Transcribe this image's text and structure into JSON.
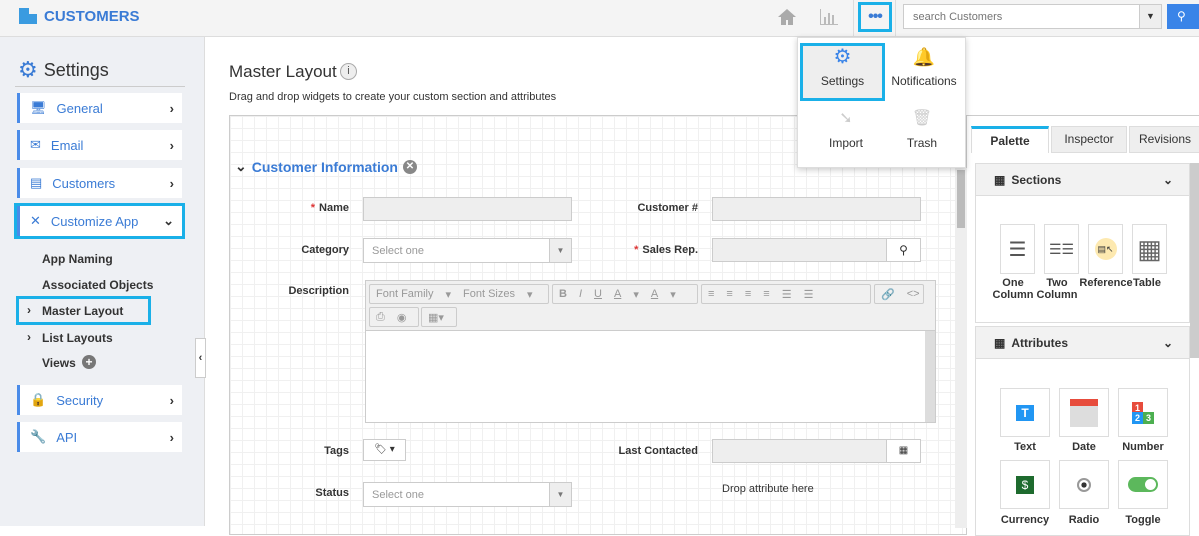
{
  "header": {
    "brand": "CUSTOMERS",
    "search_placeholder": "search Customers",
    "icons": [
      "home-icon",
      "chart-icon",
      "more-icon",
      "search-icon"
    ]
  },
  "menu": {
    "items": [
      {
        "label": "Settings",
        "icon": "gear-icon"
      },
      {
        "label": "Notifications",
        "icon": "bell-icon"
      },
      {
        "label": "Import",
        "icon": "import-icon"
      },
      {
        "label": "Trash",
        "icon": "trash-icon"
      }
    ]
  },
  "sidebar": {
    "title": "Settings",
    "items": [
      {
        "label": "General"
      },
      {
        "label": "Email"
      },
      {
        "label": "Customers"
      },
      {
        "label": "Customize App"
      },
      {
        "label": "Security"
      },
      {
        "label": "API"
      }
    ],
    "subitems": [
      "App Naming",
      "Associated Objects",
      "Master Layout",
      "List Layouts",
      "Views"
    ]
  },
  "main": {
    "title": "Master Layout",
    "subtitle": "Drag and drop widgets to create your custom section and attributes",
    "section": "Customer Information",
    "fields": {
      "name": "Name",
      "customer_no": "Customer #",
      "category": "Category",
      "category_value": "Select one",
      "sales_rep": "Sales Rep.",
      "description": "Description",
      "tags": "Tags",
      "last_contacted": "Last Contacted",
      "status": "Status",
      "status_value": "Select one",
      "drop": "Drop attribute here"
    },
    "editor": {
      "font_family": "Font Family",
      "font_sizes": "Font Sizes"
    }
  },
  "right": {
    "tabs": [
      "Palette",
      "Inspector",
      "Revisions"
    ],
    "sections_title": "Sections",
    "sections": [
      "One Column",
      "Two Column",
      "Reference",
      "Table"
    ],
    "attributes_title": "Attributes",
    "attributes": [
      "Text",
      "Date",
      "Number",
      "Currency",
      "Radio",
      "Toggle"
    ]
  },
  "colors": {
    "accent": "#3a7bd5",
    "highlight": "#1ab0e8"
  }
}
